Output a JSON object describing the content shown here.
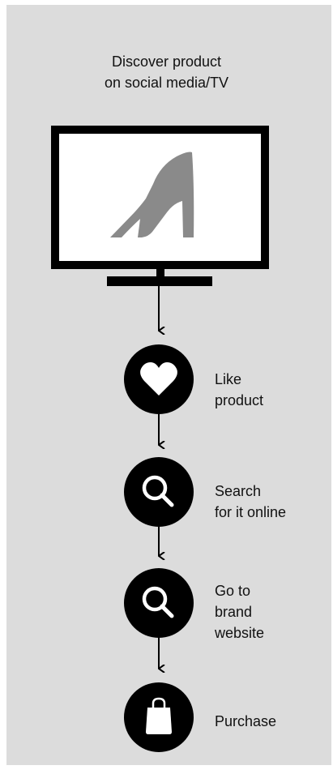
{
  "title": "Discover product\non social media/TV",
  "steps": [
    {
      "label": "Like\nproduct",
      "icon": "heart-icon"
    },
    {
      "label": "Search\nfor it online",
      "icon": "magnifier-icon"
    },
    {
      "label": "Go to\nbrand\nwebsite",
      "icon": "magnifier-icon"
    },
    {
      "label": "Purchase",
      "icon": "shopping-bag-icon"
    }
  ],
  "colors": {
    "background": "#dcdcdc",
    "ink": "#000000",
    "shoe": "#8a8a8a",
    "screen": "#ffffff"
  }
}
